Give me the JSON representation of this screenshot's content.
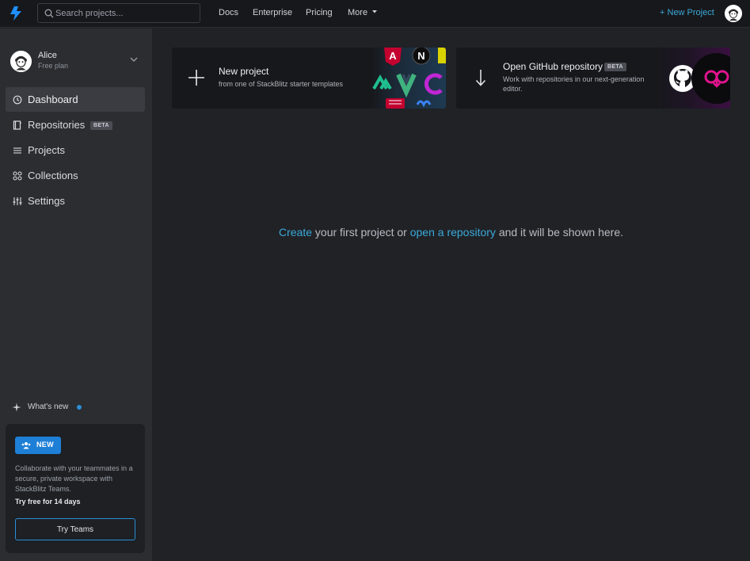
{
  "topbar": {
    "search_placeholder": "Search projects...",
    "links": [
      "Docs",
      "Enterprise",
      "Pricing",
      "More"
    ],
    "new_project": "New Project"
  },
  "sidebar": {
    "user": {
      "name": "Alice",
      "plan": "Free plan"
    },
    "items": [
      {
        "label": "Dashboard",
        "icon": "clock-icon",
        "active": true
      },
      {
        "label": "Repositories",
        "icon": "book-icon",
        "badge": "BETA"
      },
      {
        "label": "Projects",
        "icon": "list-icon"
      },
      {
        "label": "Collections",
        "icon": "grid-icon"
      },
      {
        "label": "Settings",
        "icon": "sliders-icon"
      }
    ],
    "whats_new": "What's new",
    "promo": {
      "badge": "NEW",
      "description": "Collaborate with your teammates in a secure, private workspace with StackBlitz Teams.",
      "trial": "Try free for 14 days",
      "button": "Try Teams"
    }
  },
  "cards": {
    "new_project": {
      "title": "New project",
      "subtitle": "from one of StackBlitz starter templates"
    },
    "github": {
      "title": "Open GitHub repository",
      "badge": "BETA",
      "subtitle": "Work with repositories in our next-generation editor."
    }
  },
  "empty": {
    "create": "Create",
    "middle": "your first project or",
    "open": "open a repository",
    "end": "and it will be shown here."
  },
  "colors": {
    "accent": "#3ba9d9",
    "brand_blue": "#1e7fd6",
    "background": "#202226",
    "sidebar": "#2b2d31"
  }
}
